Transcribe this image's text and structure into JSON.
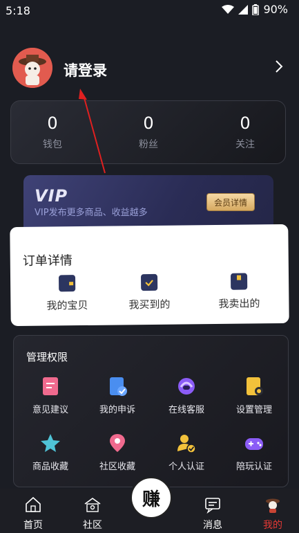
{
  "status_bar": {
    "time": "5:18",
    "battery": "90%"
  },
  "profile": {
    "login_text": "请登录"
  },
  "stats": [
    {
      "value": "0",
      "label": "钱包"
    },
    {
      "value": "0",
      "label": "粉丝"
    },
    {
      "value": "0",
      "label": "关注"
    }
  ],
  "vip": {
    "logo": "VIP",
    "subtitle": "VIP发布更多商品、收益越多",
    "button": "会员详情"
  },
  "orders": {
    "title": "订单详情",
    "items": [
      {
        "label": "我的宝贝",
        "icon": "wallet-icon"
      },
      {
        "label": "我买到的",
        "icon": "purchase-check-icon"
      },
      {
        "label": "我卖出的",
        "icon": "sold-box-icon"
      }
    ]
  },
  "management": {
    "title": "管理权限",
    "items": [
      {
        "label": "意见建议",
        "icon": "feedback-icon",
        "color": "#f06a8e"
      },
      {
        "label": "我的申诉",
        "icon": "appeal-icon",
        "color": "#4a8ef0"
      },
      {
        "label": "在线客服",
        "icon": "headset-icon",
        "color": "#8b5cf6"
      },
      {
        "label": "设置管理",
        "icon": "settings-doc-icon",
        "color": "#f2c13b"
      },
      {
        "label": "商品收藏",
        "icon": "star-icon",
        "color": "#4fc3d6"
      },
      {
        "label": "社区收藏",
        "icon": "location-pin-icon",
        "color": "#f06a8e"
      },
      {
        "label": "个人认证",
        "icon": "user-verified-icon",
        "color": "#f2c13b"
      },
      {
        "label": "陪玩认证",
        "icon": "gamepad-icon",
        "color": "#8b5cf6"
      }
    ]
  },
  "nav": {
    "items": [
      {
        "label": "首页",
        "icon": "home-icon"
      },
      {
        "label": "社区",
        "icon": "community-icon"
      },
      {
        "label": "消息",
        "icon": "message-icon"
      },
      {
        "label": "我的",
        "icon": "profile-icon",
        "active_color": "#e53935"
      }
    ],
    "center_glyph": "赚"
  }
}
